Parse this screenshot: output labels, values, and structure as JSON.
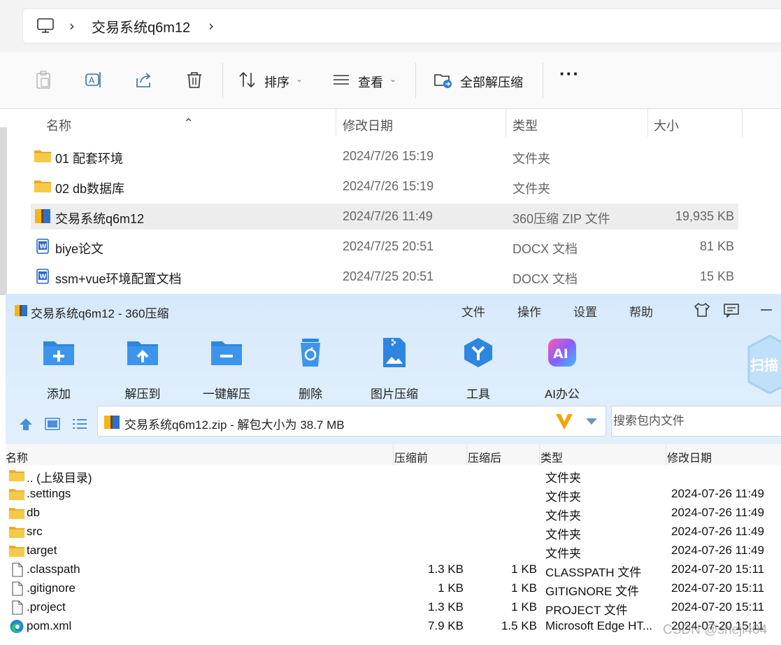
{
  "explorer": {
    "breadcrumb": "交易系统q6m12",
    "toolbar": {
      "sort_label": "排序",
      "view_label": "查看",
      "extract_all_label": "全部解压缩"
    },
    "columns": [
      "名称",
      "修改日期",
      "类型",
      "大小"
    ],
    "files": [
      {
        "name": "01 配套环境",
        "date": "2024/7/26 15:19",
        "type": "文件夹",
        "size": "",
        "icon": "folder-icon"
      },
      {
        "name": "02 db数据库",
        "date": "2024/7/26 15:19",
        "type": "文件夹",
        "size": "",
        "icon": "folder-icon"
      },
      {
        "name": "交易系统q6m12",
        "date": "2024/7/26 11:49",
        "type": "360压缩 ZIP 文件",
        "size": "19,935 KB",
        "icon": "zip-archive-icon",
        "selected": true
      },
      {
        "name": "biye论文",
        "date": "2024/7/25 20:51",
        "type": "DOCX 文档",
        "size": "81 KB",
        "icon": "word-doc-icon"
      },
      {
        "name": "ssm+vue环境配置文档",
        "date": "2024/7/25 20:51",
        "type": "DOCX 文档",
        "size": "15 KB",
        "icon": "word-doc-icon"
      }
    ]
  },
  "zip": {
    "title": "交易系统q6m12 - 360压缩",
    "menu": [
      "文件",
      "操作",
      "设置",
      "帮助"
    ],
    "tools": [
      "添加",
      "解压到",
      "一键解压",
      "删除",
      "图片压缩",
      "工具",
      "AI办公"
    ],
    "scan_label": "扫描",
    "path": "交易系统q6m12.zip - 解包大小为 38.7 MB",
    "search_placeholder": "搜索包内文件",
    "columns": [
      "名称",
      "压缩前",
      "压缩后",
      "类型",
      "修改日期"
    ],
    "entries": [
      {
        "name": ".. (上级目录)",
        "before": "",
        "after": "",
        "type": "文件夹",
        "date": "",
        "icon": "folder-icon"
      },
      {
        "name": ".settings",
        "before": "",
        "after": "",
        "type": "文件夹",
        "date": "2024-07-26 11:49",
        "icon": "folder-icon"
      },
      {
        "name": "db",
        "before": "",
        "after": "",
        "type": "文件夹",
        "date": "2024-07-26 11:49",
        "icon": "folder-icon"
      },
      {
        "name": "src",
        "before": "",
        "after": "",
        "type": "文件夹",
        "date": "2024-07-26 11:49",
        "icon": "folder-icon"
      },
      {
        "name": "target",
        "before": "",
        "after": "",
        "type": "文件夹",
        "date": "2024-07-26 11:49",
        "icon": "folder-icon"
      },
      {
        "name": ".classpath",
        "before": "1.3 KB",
        "after": "1 KB",
        "type": "CLASSPATH 文件",
        "date": "2024-07-20 15:11",
        "icon": "file-icon"
      },
      {
        "name": ".gitignore",
        "before": "1 KB",
        "after": "1 KB",
        "type": "GITIGNORE 文件",
        "date": "2024-07-20 15:11",
        "icon": "file-icon"
      },
      {
        "name": ".project",
        "before": "1.3 KB",
        "after": "1 KB",
        "type": "PROJECT 文件",
        "date": "2024-07-20 15:11",
        "icon": "file-icon"
      },
      {
        "name": "pom.xml",
        "before": "7.9 KB",
        "after": "1.5 KB",
        "type": "Microsoft Edge HT...",
        "date": "2024-07-20 15:11",
        "icon": "edge-icon"
      }
    ]
  },
  "watermark": "CSDN @sheji404",
  "colors": {
    "accent_blue": "#2f86e0",
    "folder_yellow": "#f7c948",
    "zip_header": "#d6e9fb"
  }
}
